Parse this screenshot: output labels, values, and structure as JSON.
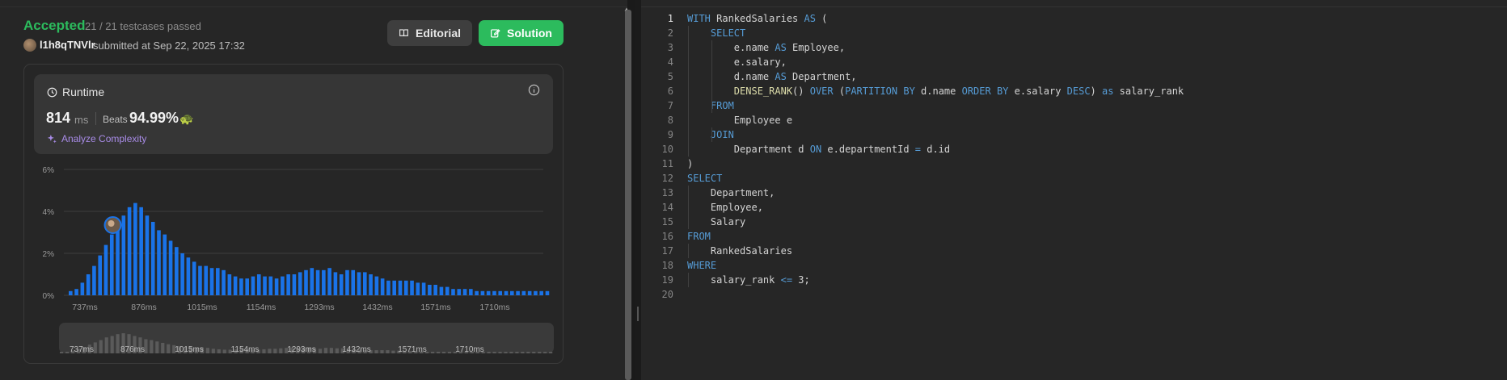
{
  "result": {
    "status": "Accepted",
    "testcases": "21 / 21 testcases passed",
    "username": "l1h8qTNVlr",
    "submitted_at": "submitted at Sep 22, 2025 17:32"
  },
  "buttons": {
    "editorial": "Editorial",
    "solution": "Solution"
  },
  "runtime": {
    "title": "Runtime",
    "value": "814",
    "unit": "ms",
    "beats_label": "Beats",
    "beats_value": "94.99%",
    "analyze": "Analyze Complexity"
  },
  "chart_data": {
    "type": "bar",
    "y_ticks": [
      "6%",
      "4%",
      "2%",
      "0%"
    ],
    "ylim": [
      0,
      6
    ],
    "x_tick_labels": [
      "737ms",
      "876ms",
      "1015ms",
      "1154ms",
      "1293ms",
      "1432ms",
      "1571ms",
      "1710ms"
    ],
    "values": [
      0.2,
      0.3,
      0.6,
      1.0,
      1.4,
      1.9,
      2.4,
      2.9,
      3.5,
      3.8,
      4.2,
      4.4,
      4.2,
      3.8,
      3.5,
      3.1,
      2.9,
      2.6,
      2.3,
      2.0,
      1.8,
      1.6,
      1.4,
      1.4,
      1.3,
      1.3,
      1.2,
      1.0,
      0.9,
      0.8,
      0.8,
      0.9,
      1.0,
      0.9,
      0.9,
      0.8,
      0.9,
      1.0,
      1.0,
      1.1,
      1.2,
      1.3,
      1.2,
      1.2,
      1.3,
      1.1,
      1.0,
      1.2,
      1.2,
      1.1,
      1.1,
      1.0,
      0.9,
      0.8,
      0.7,
      0.7,
      0.7,
      0.7,
      0.7,
      0.6,
      0.6,
      0.5,
      0.5,
      0.4,
      0.4,
      0.3,
      0.3,
      0.3,
      0.3,
      0.2,
      0.2,
      0.2,
      0.2,
      0.2,
      0.2,
      0.2,
      0.2,
      0.2,
      0.2,
      0.2,
      0.2,
      0.2,
      0.2,
      0.2,
      0.2,
      0.2,
      0.2,
      0.2
    ],
    "highlight_index": 8,
    "bar_color": "#1a73e8",
    "grid": true
  },
  "editor": {
    "lines": [
      [
        [
          "kw",
          "WITH"
        ],
        [
          "t",
          " RankedSalaries "
        ],
        [
          "kw",
          "AS"
        ],
        [
          "t",
          " ("
        ]
      ],
      [
        [
          "t",
          "    "
        ],
        [
          "kw",
          "SELECT"
        ]
      ],
      [
        [
          "t",
          "        e.name "
        ],
        [
          "kw",
          "AS"
        ],
        [
          "t",
          " Employee,"
        ]
      ],
      [
        [
          "t",
          "        e.salary,"
        ]
      ],
      [
        [
          "t",
          "        d.name "
        ],
        [
          "kw",
          "AS"
        ],
        [
          "t",
          " Department,"
        ]
      ],
      [
        [
          "t",
          "        "
        ],
        [
          "fn",
          "DENSE_RANK"
        ],
        [
          "t",
          "() "
        ],
        [
          "kw",
          "OVER"
        ],
        [
          "t",
          " ("
        ],
        [
          "kw",
          "PARTITION BY"
        ],
        [
          "t",
          " d.name "
        ],
        [
          "kw",
          "ORDER BY"
        ],
        [
          "t",
          " e.salary "
        ],
        [
          "kw",
          "DESC"
        ],
        [
          "t",
          ") "
        ],
        [
          "kw",
          "as"
        ],
        [
          "t",
          " salary_rank"
        ]
      ],
      [
        [
          "t",
          "    "
        ],
        [
          "kw",
          "FROM"
        ]
      ],
      [
        [
          "t",
          "        Employee e"
        ]
      ],
      [
        [
          "t",
          "    "
        ],
        [
          "kw",
          "JOIN"
        ]
      ],
      [
        [
          "t",
          "        Department d "
        ],
        [
          "kw",
          "ON"
        ],
        [
          "t",
          " e.departmentId "
        ],
        [
          "kw",
          "="
        ],
        [
          "t",
          " d.id"
        ]
      ],
      [
        [
          "t",
          ")"
        ]
      ],
      [
        [
          "kw",
          "SELECT"
        ]
      ],
      [
        [
          "t",
          "    Department,"
        ]
      ],
      [
        [
          "t",
          "    Employee,"
        ]
      ],
      [
        [
          "t",
          "    Salary"
        ]
      ],
      [
        [
          "kw",
          "FROM"
        ]
      ],
      [
        [
          "t",
          "    RankedSalaries"
        ]
      ],
      [
        [
          "kw",
          "WHERE"
        ]
      ],
      [
        [
          "t",
          "    salary_rank "
        ],
        [
          "kw",
          "<="
        ],
        [
          "t",
          " 3;"
        ]
      ],
      []
    ],
    "active_line": 1
  }
}
